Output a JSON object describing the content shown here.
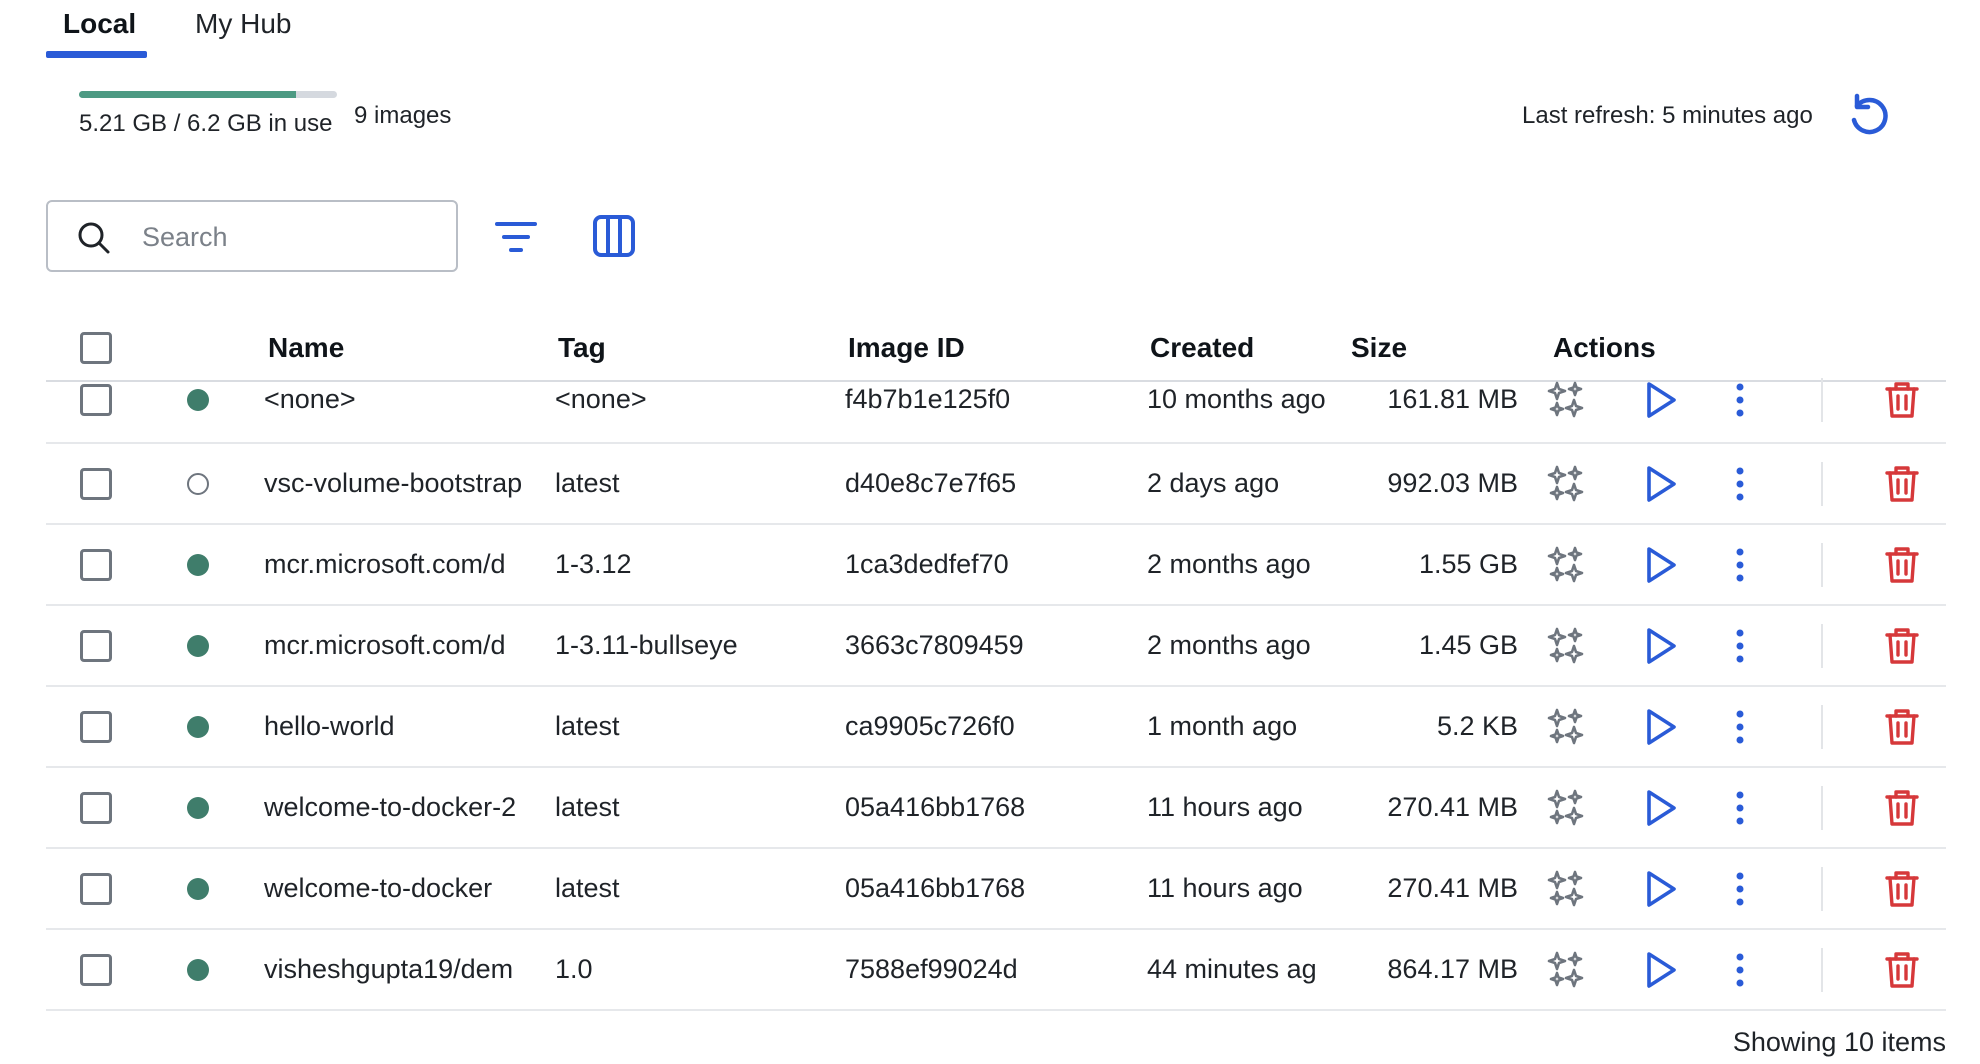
{
  "tabs": [
    {
      "label": "Local",
      "active": true
    },
    {
      "label": "My Hub",
      "active": false
    }
  ],
  "usage": {
    "text": "5.21 GB / 6.2 GB in use",
    "fraction": 0.84,
    "images_count": "9 images"
  },
  "refresh": {
    "text": "Last refresh: 5 minutes ago",
    "icon": "refresh-icon"
  },
  "search": {
    "placeholder": "Search",
    "value": ""
  },
  "toolbar": {
    "filter_icon": "filter-icon",
    "columns_icon": "columns-icon"
  },
  "table": {
    "columns": [
      "Name",
      "Tag",
      "Image ID",
      "Created",
      "Size",
      "Actions"
    ],
    "rows": [
      {
        "status": "in-use",
        "name": "<none>",
        "tag": "<none>",
        "image_id": "f4b7b1e125f0",
        "created": "10 months ago",
        "size": "161.81 MB"
      },
      {
        "status": "unused",
        "name": "vsc-volume-bootstrap",
        "tag": "latest",
        "image_id": "d40e8c7e7f65",
        "created": "2 days ago",
        "size": "992.03 MB"
      },
      {
        "status": "in-use",
        "name": "mcr.microsoft.com/d",
        "tag": "1-3.12",
        "image_id": "1ca3dedfef70",
        "created": "2 months ago",
        "size": "1.55 GB"
      },
      {
        "status": "in-use",
        "name": "mcr.microsoft.com/d",
        "tag": "1-3.11-bullseye",
        "image_id": "3663c7809459",
        "created": "2 months ago",
        "size": "1.45 GB"
      },
      {
        "status": "in-use",
        "name": "hello-world",
        "tag": "latest",
        "image_id": "ca9905c726f0",
        "created": "1 month ago",
        "size": "5.2 KB"
      },
      {
        "status": "in-use",
        "name": "welcome-to-docker-2",
        "tag": "latest",
        "image_id": "05a416bb1768",
        "created": "11 hours ago",
        "size": "270.41 MB"
      },
      {
        "status": "in-use",
        "name": "welcome-to-docker",
        "tag": "latest",
        "image_id": "05a416bb1768",
        "created": "11 hours ago",
        "size": "270.41 MB"
      },
      {
        "status": "in-use",
        "name": "visheshgupta19/dem",
        "tag": "1.0",
        "image_id": "7588ef99024d",
        "created": "44 minutes ag",
        "size": "864.17 MB"
      }
    ]
  },
  "row_actions": [
    "sparkle-icon",
    "play-icon",
    "more-vertical-icon",
    "trash-icon"
  ],
  "colors": {
    "accent": "#2a5bd7",
    "in_use": "#3f7d6b",
    "usage_fill": "#4d9a83",
    "danger": "#d6383a"
  },
  "footer": {
    "text": "Showing 10 items"
  }
}
